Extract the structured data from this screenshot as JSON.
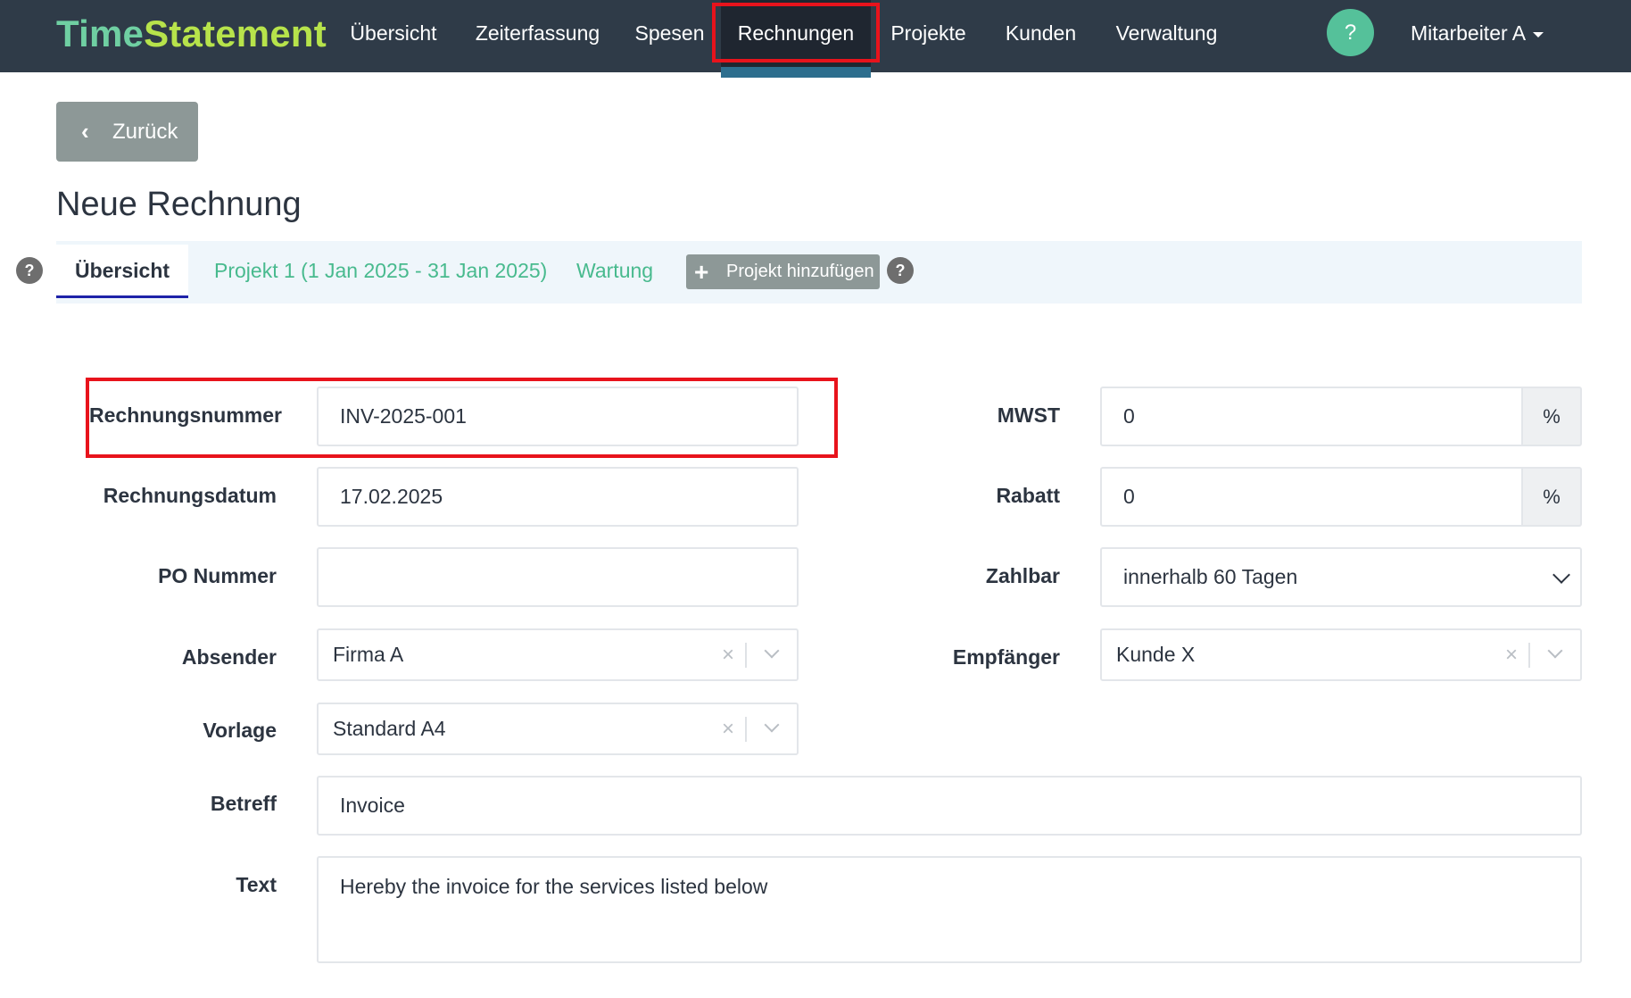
{
  "navbar": {
    "brand_part1": "Time",
    "brand_part2": "Statement",
    "items": [
      {
        "label": "Übersicht"
      },
      {
        "label": "Zeiterfassung"
      },
      {
        "label": "Spesen"
      },
      {
        "label": "Rechnungen",
        "active": true
      },
      {
        "label": "Projekte"
      },
      {
        "label": "Kunden"
      },
      {
        "label": "Verwaltung"
      }
    ],
    "help_label": "?",
    "user_label": "Mitarbeiter A"
  },
  "back_button": {
    "label": "Zurück"
  },
  "page": {
    "title": "Neue Rechnung"
  },
  "tabs": {
    "help_left": "?",
    "help_right": "?",
    "items": [
      {
        "label": "Übersicht",
        "active": true
      },
      {
        "label": "Projekt 1 (1 Jan 2025 - 31 Jan 2025)"
      },
      {
        "label": "Wartung"
      }
    ],
    "add_project_label": "Projekt hinzufügen"
  },
  "form": {
    "invoice_number": {
      "label": "Rechnungsnummer",
      "value": "INV-2025-001"
    },
    "invoice_date": {
      "label": "Rechnungsdatum",
      "value": "17.02.2025"
    },
    "po_number": {
      "label": "PO Nummer",
      "value": ""
    },
    "sender": {
      "label": "Absender",
      "value": "Firma A"
    },
    "template": {
      "label": "Vorlage",
      "value": "Standard A4"
    },
    "subject": {
      "label": "Betreff",
      "value": "Invoice"
    },
    "text": {
      "label": "Text",
      "value": "Hereby the invoice for the services listed below"
    },
    "vat": {
      "label": "MWST",
      "value": "0",
      "unit": "%"
    },
    "discount": {
      "label": "Rabatt",
      "value": "0",
      "unit": "%"
    },
    "payable": {
      "label": "Zahlbar",
      "value": "innerhalb 60 Tagen"
    },
    "recipient": {
      "label": "Empfänger",
      "value": "Kunde X"
    }
  },
  "clear_glyph": "×",
  "colors": {
    "navbar_bg": "#2f3b48",
    "brand_time": "#6fcfa2",
    "brand_statement": "#b7e34b",
    "link_green": "#48ba8e",
    "highlight_red": "#e8131c",
    "tab_underline": "#1e22a8"
  }
}
